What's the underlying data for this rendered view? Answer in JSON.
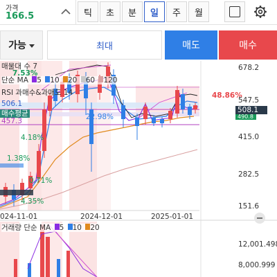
{
  "header": {
    "price_label": "가격",
    "price_value": "166.5",
    "period_tabs": [
      "틱",
      "초",
      "분",
      "일",
      "주",
      "월"
    ],
    "active_tab": "일"
  },
  "order": {
    "available_label": "가능",
    "max_label": "최대",
    "sell_label": "매도",
    "buy_label": "매수"
  },
  "chart": {
    "price_axis_labels": [
      "678.2",
      "547.5",
      "415.0",
      "282.5",
      "151.6"
    ],
    "current_price_tag": "508.1",
    "secondary_price_tag": "490.8",
    "high_tag": "506.1",
    "low_tag": "457.3",
    "date_labels": [
      "024-11-01",
      "2024-12-01",
      "2025-01-01"
    ],
    "indicator_labels": {
      "sales_qty": "매물대 수 7",
      "ma": "단순 MA",
      "ma_periods": [
        "5",
        "10",
        "20",
        "60",
        "120"
      ],
      "rsi": "RSI 과매수&과매도 14",
      "avg_buy": "매수평균"
    },
    "annotations": {
      "pct_7_53": "7.53%",
      "pct_48_86": "48.86%",
      "pct_22_98": "22.98%",
      "pct_4_18": "4.18%",
      "pct_1_38": "1.38%",
      "pct_0_71": "0.71%",
      "pct_4_35": "4.35%"
    },
    "volume_axis_labels": [
      "12,001.498",
      "8,000.999"
    ],
    "volume_indicator": {
      "label": "거래량 단순 MA",
      "periods": [
        "5",
        "10",
        "20"
      ]
    }
  },
  "colors": {
    "up": "#e8484c",
    "down": "#2f7fe6",
    "price_green": "#1a9a5a",
    "accent_blue": "#2f5ec9",
    "ma5": "#8a2be2",
    "ma10": "#2f7fe6",
    "ma20": "#e08a1e",
    "ma60": "#c8c8c8",
    "ma120": "#d9a0a0"
  },
  "icons": {
    "chevron": "chevron-up-icon",
    "square": "square-outline-icon",
    "gear": "gear-icon"
  }
}
